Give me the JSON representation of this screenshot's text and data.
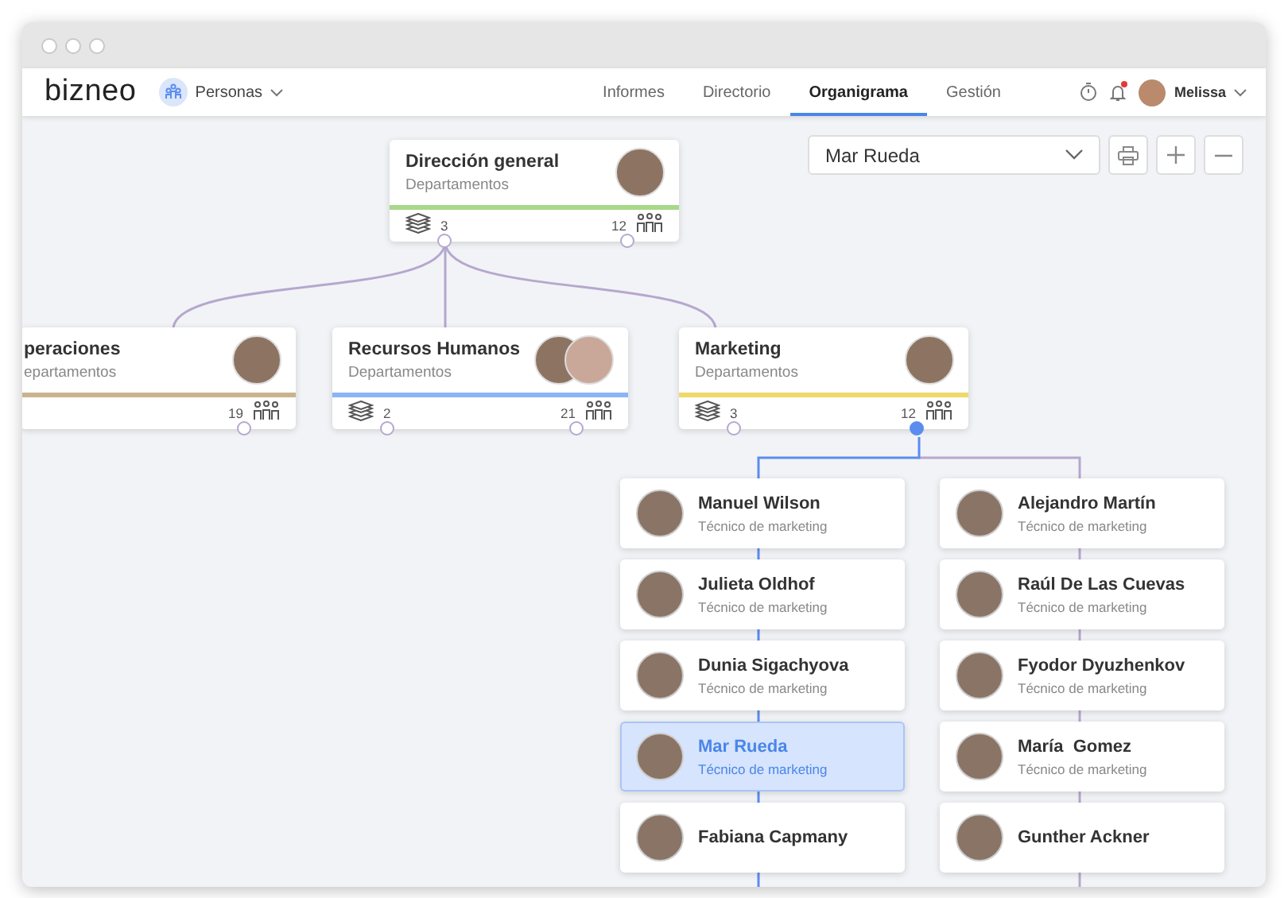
{
  "header": {
    "logo": "bizneo",
    "module": "Personas",
    "tabs": [
      {
        "label": "Informes",
        "selected": false
      },
      {
        "label": "Directorio",
        "selected": false
      },
      {
        "label": "Organigrama",
        "selected": true
      },
      {
        "label": "Gestión",
        "selected": false
      }
    ],
    "notifications": true,
    "user": "Melissa"
  },
  "toolbar": {
    "search_select": "Mar Rueda"
  },
  "departments": [
    {
      "name": "Dirección general",
      "subtitle": "Departamentos",
      "color": "#a8d88a",
      "group_photo": false,
      "subdepartments": "3",
      "people": "12",
      "expanded": false
    },
    {
      "name": "peraciones",
      "subtitle": "epartamentos",
      "color": "#c9b38f",
      "group_photo": false,
      "people": "19",
      "expanded": false
    },
    {
      "name": "Recursos Humanos",
      "subtitle": "Departamentos",
      "color": "#8ab4f8",
      "group_photo": true,
      "subdepartments": "2",
      "people": "21",
      "expanded": false
    },
    {
      "name": "Marketing",
      "subtitle": "Departamentos",
      "color": "#efd96a",
      "group_photo": false,
      "subdepartments": "3",
      "people": "12",
      "expanded": true
    }
  ],
  "employee_columns": [
    {
      "highlighted": true,
      "employees": [
        {
          "name": "Manuel Wilson",
          "role": "Técnico de marketing",
          "selected": false
        },
        {
          "name": "Julieta Oldhof",
          "role": "Técnico de marketing",
          "selected": false
        },
        {
          "name": "Dunia Sigachyova",
          "role": "Técnico de marketing",
          "selected": false
        },
        {
          "name": "Mar Rueda",
          "role": "Técnico de marketing",
          "selected": true
        },
        {
          "name": "Fabiana Capmany",
          "selected": false
        }
      ]
    },
    {
      "highlighted": false,
      "employees": [
        {
          "name": "Alejandro Martín",
          "role": "Técnico de marketing",
          "selected": false
        },
        {
          "name": "Raúl De Las Cuevas",
          "role": "Técnico de marketing",
          "selected": false
        },
        {
          "name": "Fyodor Dyuzhenkov",
          "role": "Técnico de marketing",
          "selected": false
        },
        {
          "name": "María  Gomez",
          "role": "Técnico de marketing",
          "selected": false
        },
        {
          "name": "Gunther Ackner",
          "selected": false
        }
      ]
    }
  ]
}
